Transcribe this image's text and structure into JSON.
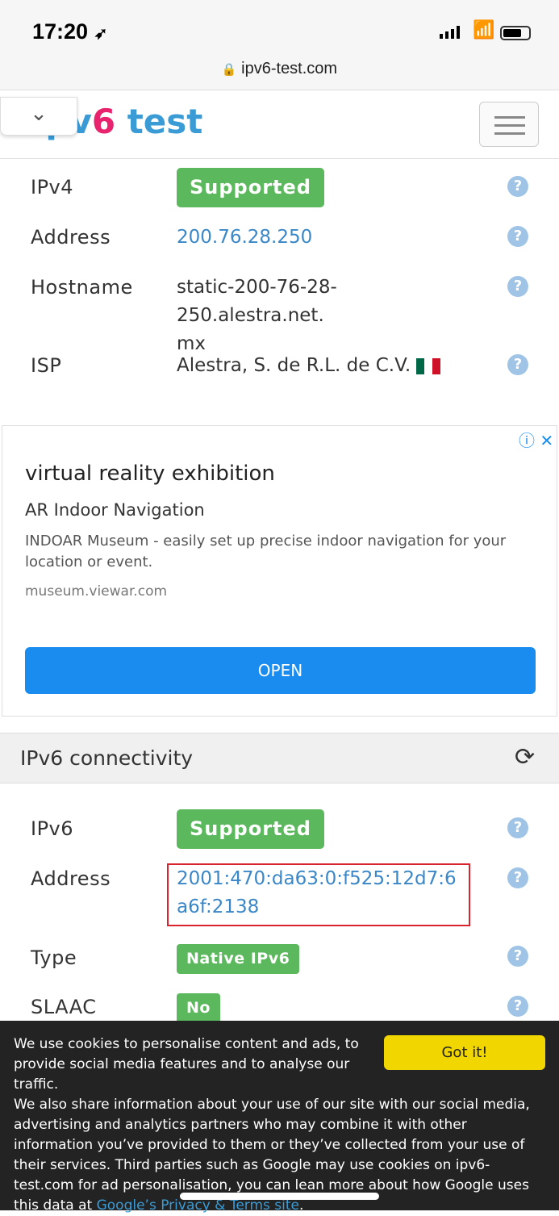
{
  "status_bar": {
    "time": "17:20",
    "location_icon": "location-arrow-icon",
    "signal_icon": "signal-icon",
    "wifi_icon": "wifi-icon",
    "battery_icon": "battery-icon"
  },
  "browser": {
    "url": "ipv6-test.com",
    "lock_icon": "lock-icon"
  },
  "header": {
    "logo_part1": "ipv",
    "logo_part2": "6",
    "logo_part3": " test",
    "collapse_icon": "chevron-down-icon",
    "menu_icon": "hamburger-icon"
  },
  "ipv4": {
    "rows": [
      {
        "label": "IPv4",
        "value": "Supported"
      },
      {
        "label": "Address",
        "value": "200.76.28.250"
      },
      {
        "label": "Hostname",
        "value": "static-200-76-28-250.alestra.net.mx"
      },
      {
        "label": "ISP",
        "value": "Alestra, S. de R.L. de C.V.",
        "flag": "MX"
      }
    ]
  },
  "ad": {
    "title": "virtual reality exhibition",
    "subtitle": "AR Indoor Navigation",
    "description": "INDOAR Museum - easily set up precise indoor navigation for your location or event.",
    "domain": "museum.viewar.com",
    "button": "OPEN",
    "info_icon": "ⓘ",
    "close_icon": "✕"
  },
  "ipv6": {
    "section_title": "IPv6 connectivity",
    "rows": [
      {
        "label": "IPv6",
        "value": "Supported"
      },
      {
        "label": "Address",
        "value": "2001:470:da63:0:f525:12d7:6a6f:2138"
      },
      {
        "label": "Type",
        "value": "Native IPv6"
      },
      {
        "label": "SLAAC",
        "value": "No"
      }
    ]
  },
  "cookie": {
    "text": "We use cookies to personalise content and ads, to provide social media features and to analyse our traffic.",
    "text2": "We also share information about your use of our site with our social media, advertising and analytics partners who may combine it with other information you’ve provided to them or they’ve collected from your use of their services. Third parties such as Google may use cookies on ipv6-test.com for ad personalisation, you can lean more about how Google uses this data at ",
    "link": "Google’s Privacy & Terms site",
    "end": ".",
    "button": "Got it!"
  },
  "colors": {
    "badge": "#5cb85c",
    "link": "#3a87c8",
    "highlight": "#d9232e",
    "cookie_button": "#f1d600"
  }
}
